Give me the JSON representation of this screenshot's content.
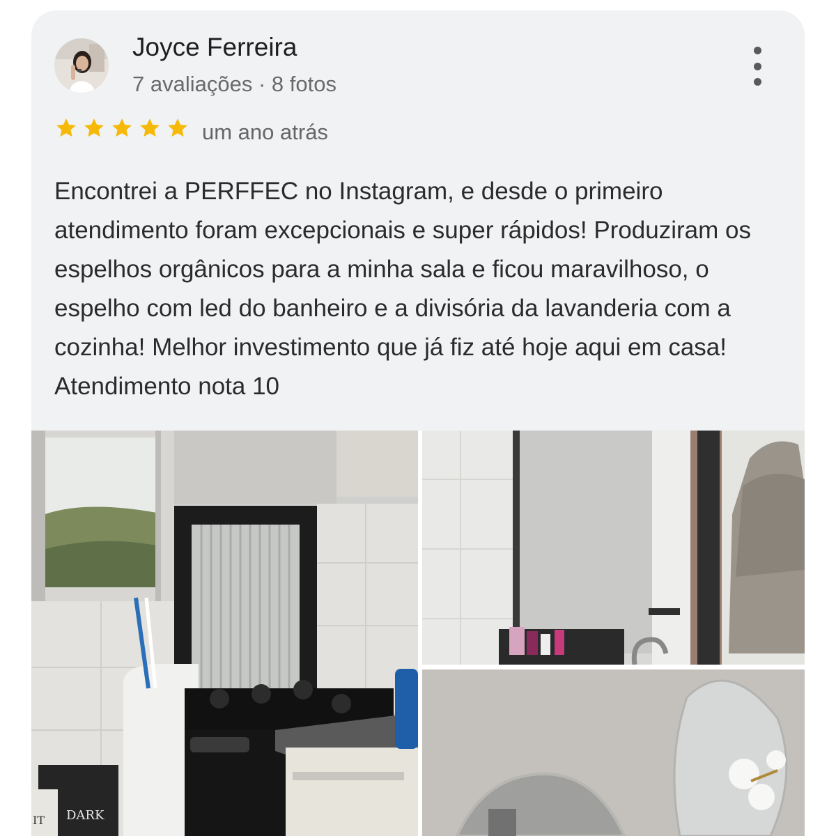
{
  "review": {
    "author_name": "Joyce Ferreira",
    "author_meta": "7 avaliações · 8 fotos",
    "rating": 5,
    "rating_max": 5,
    "date": "um ano atrás",
    "text": "Encontrei a PERFFEC no Instagram, e desde o primeiro atendimento foram excepcionais e super rápidos! Produziram os espelhos orgânicos para a minha sala e ficou maravilhoso, o espelho com led do banheiro e a divisória da lavanderia com a cozinha! Melhor investimento que já fiz até hoje aqui em casa! Atendimento nota 10",
    "icons": {
      "menu": "more-vert-icon",
      "star": "star-icon"
    },
    "colors": {
      "star": "#f6b907",
      "card_bg": "#f1f2f4"
    }
  },
  "photos": [
    {
      "name": "photo-kitchen-laundry",
      "labels": [
        "DARK",
        "IT"
      ]
    },
    {
      "name": "photo-bathroom-mirror"
    },
    {
      "name": "photo-organic-mirror"
    }
  ]
}
